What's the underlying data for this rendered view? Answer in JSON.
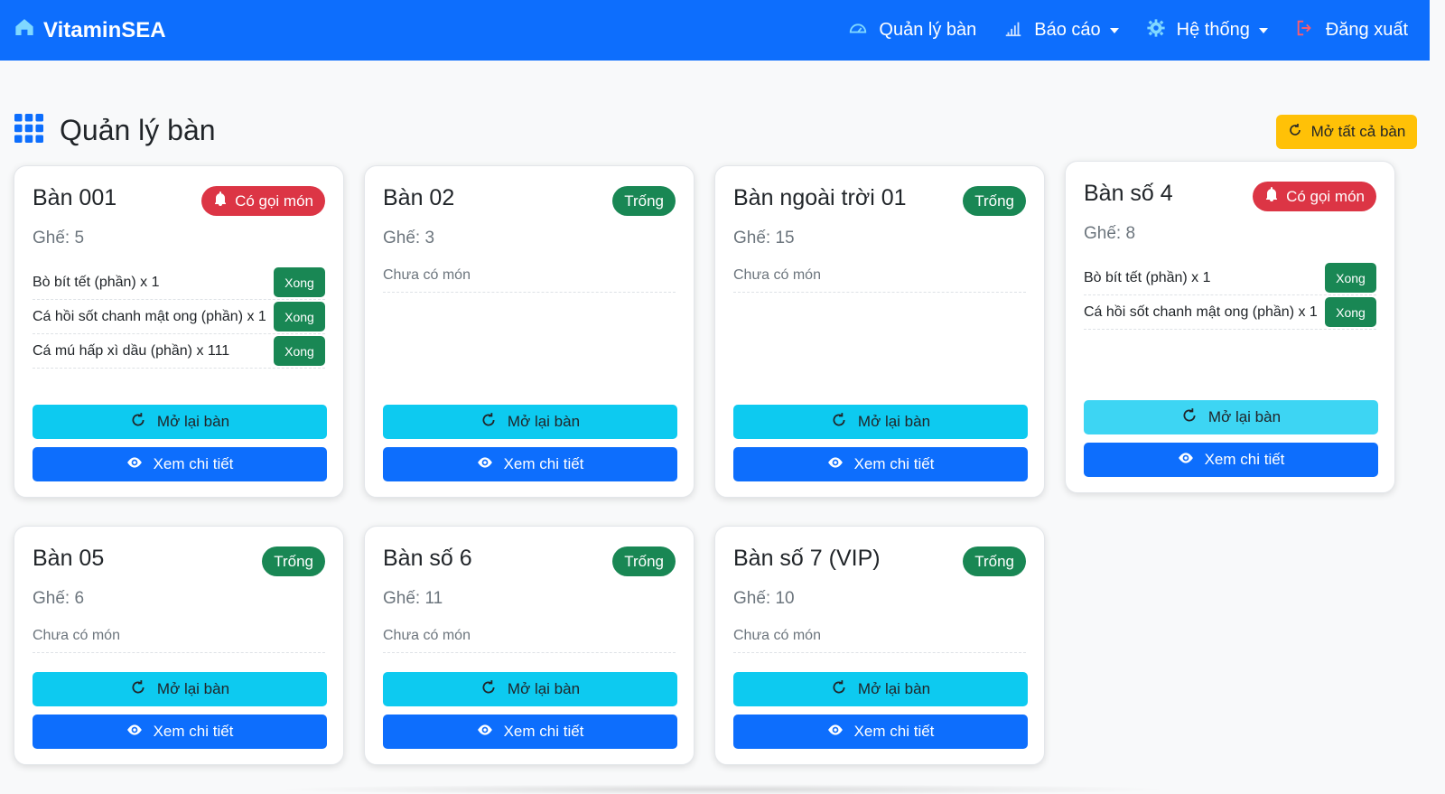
{
  "navbar": {
    "brand": "VitaminSEA",
    "items": [
      {
        "label": "Quản lý bàn",
        "icon": "speedometer-icon",
        "dropdown": false
      },
      {
        "label": "Báo cáo",
        "icon": "bar-chart-icon",
        "dropdown": true
      },
      {
        "label": "Hệ thống",
        "icon": "gear-icon",
        "dropdown": true
      },
      {
        "label": "Đăng xuất",
        "icon": "logout-icon",
        "dropdown": false
      }
    ]
  },
  "page": {
    "title": "Quản lý bàn",
    "open_all_label": "Mở tất cả bàn"
  },
  "colors": {
    "primary": "#0d6efd",
    "info": "#0dcaf0",
    "warning": "#ffc107",
    "success": "#198754",
    "danger": "#dc3545"
  },
  "card_labels": {
    "reopen": "Mở lại bàn",
    "view": "Xem chi tiết",
    "done": "Xong",
    "empty": "Chưa có món"
  },
  "tables": [
    {
      "name": "Bàn 001",
      "status": "Có gọi món",
      "status_type": "ordered",
      "seats": "Ghế: 5",
      "items": [
        "Bò bít tết (phần) x 1",
        "Cá hồi sốt chanh mật ong (phần) x 1",
        "Cá mú hấp xì dầu (phần) x 111"
      ]
    },
    {
      "name": "Bàn 02",
      "status": "Trống",
      "status_type": "empty",
      "seats": "Ghế: 3",
      "items": []
    },
    {
      "name": "Bàn ngoài trời 01",
      "status": "Trống",
      "status_type": "empty",
      "seats": "Ghế: 15",
      "items": []
    },
    {
      "name": "Bàn số 4",
      "status": "Có gọi món",
      "status_type": "ordered",
      "seats": "Ghế: 8",
      "items": [
        "Bò bít tết (phần) x 1",
        "Cá hồi sốt chanh mật ong (phần) x 1"
      ]
    },
    {
      "name": "Bàn 05",
      "status": "Trống",
      "status_type": "empty",
      "seats": "Ghế: 6",
      "items": []
    },
    {
      "name": "Bàn số 6",
      "status": "Trống",
      "status_type": "empty",
      "seats": "Ghế: 11",
      "items": []
    },
    {
      "name": "Bàn số 7 (VIP)",
      "status": "Trống",
      "status_type": "empty",
      "seats": "Ghế: 10",
      "items": []
    }
  ]
}
